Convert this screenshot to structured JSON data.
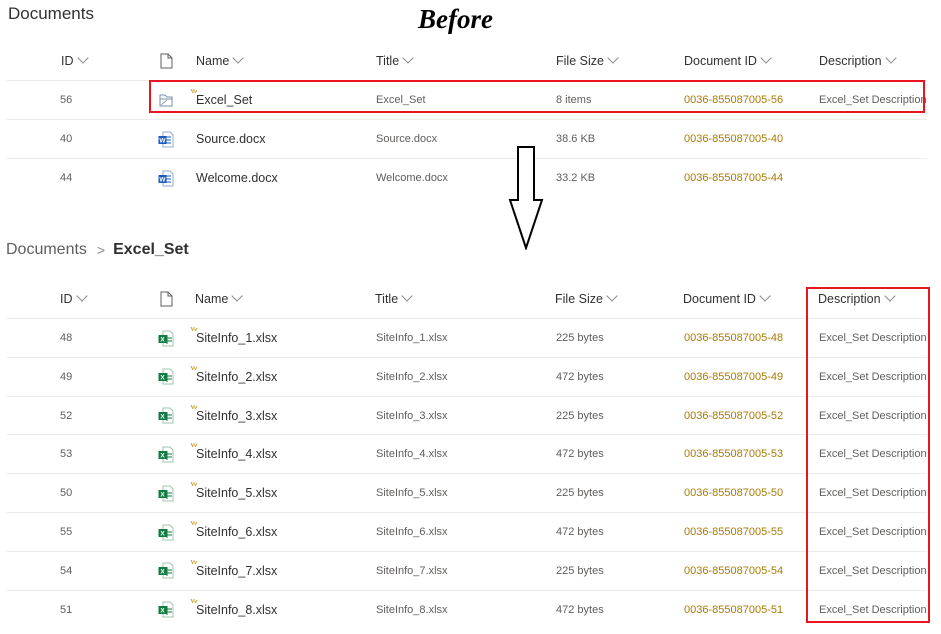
{
  "top_section": {
    "title": "Documents",
    "annotation": "Before",
    "columns": {
      "id": "ID",
      "name": "Name",
      "title": "Title",
      "file_size": "File Size",
      "document_id": "Document ID",
      "description": "Description"
    },
    "rows": [
      {
        "id": "56",
        "icon": "folder-icon",
        "name": "Excel_Set",
        "title": "Excel_Set",
        "size": "8 items",
        "doc_id": "0036-855087005-56",
        "description": "Excel_Set Description",
        "is_new": true
      },
      {
        "id": "40",
        "icon": "word-file-icon",
        "name": "Source.docx",
        "title": "Source.docx",
        "size": "38.6 KB",
        "doc_id": "0036-855087005-40",
        "description": "",
        "is_new": false
      },
      {
        "id": "44",
        "icon": "word-file-icon",
        "name": "Welcome.docx",
        "title": "Welcome.docx",
        "size": "33.2 KB",
        "doc_id": "0036-855087005-44",
        "description": "",
        "is_new": false
      }
    ]
  },
  "bottom_section": {
    "breadcrumb": {
      "root": "Documents",
      "separator": ">",
      "current": "Excel_Set"
    },
    "columns": {
      "id": "ID",
      "name": "Name",
      "title": "Title",
      "file_size": "File Size",
      "document_id": "Document ID",
      "description": "Description"
    },
    "rows": [
      {
        "id": "48",
        "icon": "excel-file-icon",
        "name": "SiteInfo_1.xlsx",
        "title": "SiteInfo_1.xlsx",
        "size": "225 bytes",
        "doc_id": "0036-855087005-48",
        "description": "Excel_Set Description"
      },
      {
        "id": "49",
        "icon": "excel-file-icon",
        "name": "SiteInfo_2.xlsx",
        "title": "SiteInfo_2.xlsx",
        "size": "472 bytes",
        "doc_id": "0036-855087005-49",
        "description": "Excel_Set Description"
      },
      {
        "id": "52",
        "icon": "excel-file-icon",
        "name": "SiteInfo_3.xlsx",
        "title": "SiteInfo_3.xlsx",
        "size": "225 bytes",
        "doc_id": "0036-855087005-52",
        "description": "Excel_Set Description"
      },
      {
        "id": "53",
        "icon": "excel-file-icon",
        "name": "SiteInfo_4.xlsx",
        "title": "SiteInfo_4.xlsx",
        "size": "472 bytes",
        "doc_id": "0036-855087005-53",
        "description": "Excel_Set Description"
      },
      {
        "id": "50",
        "icon": "excel-file-icon",
        "name": "SiteInfo_5.xlsx",
        "title": "SiteInfo_5.xlsx",
        "size": "225 bytes",
        "doc_id": "0036-855087005-50",
        "description": "Excel_Set Description"
      },
      {
        "id": "55",
        "icon": "excel-file-icon",
        "name": "SiteInfo_6.xlsx",
        "title": "SiteInfo_6.xlsx",
        "size": "472 bytes",
        "doc_id": "0036-855087005-55",
        "description": "Excel_Set Description"
      },
      {
        "id": "54",
        "icon": "excel-file-icon",
        "name": "SiteInfo_7.xlsx",
        "title": "SiteInfo_7.xlsx",
        "size": "225 bytes",
        "doc_id": "0036-855087005-54",
        "description": "Excel_Set Description"
      },
      {
        "id": "51",
        "icon": "excel-file-icon",
        "name": "SiteInfo_8.xlsx",
        "title": "SiteInfo_8.xlsx",
        "size": "472 bytes",
        "doc_id": "0036-855087005-51",
        "description": "Excel_Set Description"
      }
    ]
  },
  "colors": {
    "highlight": "#e8141e",
    "document_id_text": "#a87b05",
    "word_blue": "#185abd",
    "excel_green": "#107c41",
    "new_item_mark": "#c8a02a"
  }
}
